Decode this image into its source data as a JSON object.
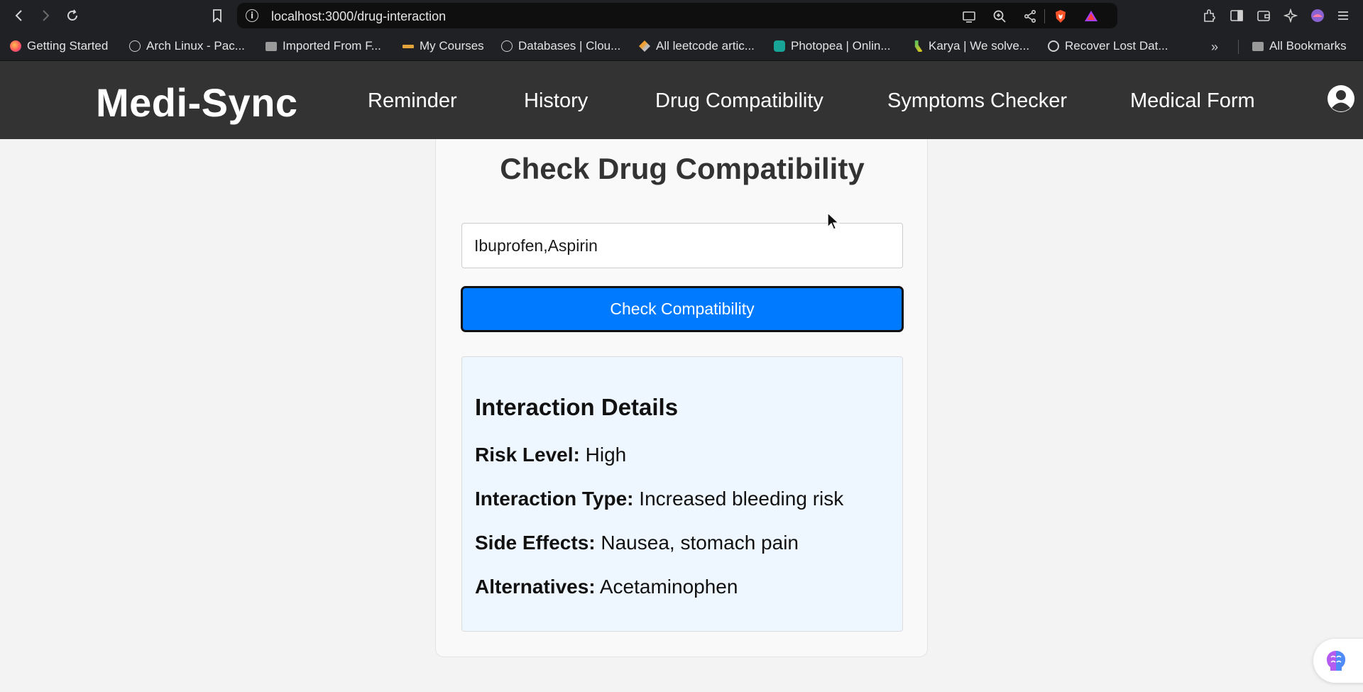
{
  "browser": {
    "url": "localhost:3000/drug-interaction",
    "bookmarks": [
      {
        "label": "Getting Started",
        "icon": "firefox-icon"
      },
      {
        "label": "Arch Linux - Pac...",
        "icon": "globe-icon"
      },
      {
        "label": "Imported From F...",
        "icon": "folder-icon"
      },
      {
        "label": "My Courses",
        "icon": "course-icon"
      },
      {
        "label": "Databases | Clou...",
        "icon": "globe-icon"
      },
      {
        "label": "All leetcode artic...",
        "icon": "leetcode-icon"
      },
      {
        "label": "Photopea | Onlin...",
        "icon": "photopea-icon"
      },
      {
        "label": "Karya | We solve...",
        "icon": "karya-icon"
      },
      {
        "label": "Recover Lost Dat...",
        "icon": "openai-icon"
      }
    ],
    "more_bookmarks": "»",
    "all_bookmarks": "All Bookmarks"
  },
  "header": {
    "brand": "Medi-Sync",
    "nav": [
      "Reminder",
      "History",
      "Drug Compatibility",
      "Symptoms Checker",
      "Medical Form"
    ]
  },
  "main": {
    "title": "Check Drug Compatibility",
    "input_value": "Ibuprofen,Aspirin",
    "button_label": "Check Compatibility",
    "details": {
      "heading": "Interaction Details",
      "risk_label": "Risk Level:",
      "risk_value": "High",
      "type_label": "Interaction Type:",
      "type_value": "Increased bleeding risk",
      "side_label": "Side Effects:",
      "side_value": "Nausea, stomach pain",
      "alt_label": "Alternatives:",
      "alt_value": "Acetaminophen"
    }
  },
  "colors": {
    "header_bg": "#333333",
    "button_blue": "#007bff",
    "details_bg": "#eef6ff",
    "page_bg": "#f3f3f3"
  }
}
